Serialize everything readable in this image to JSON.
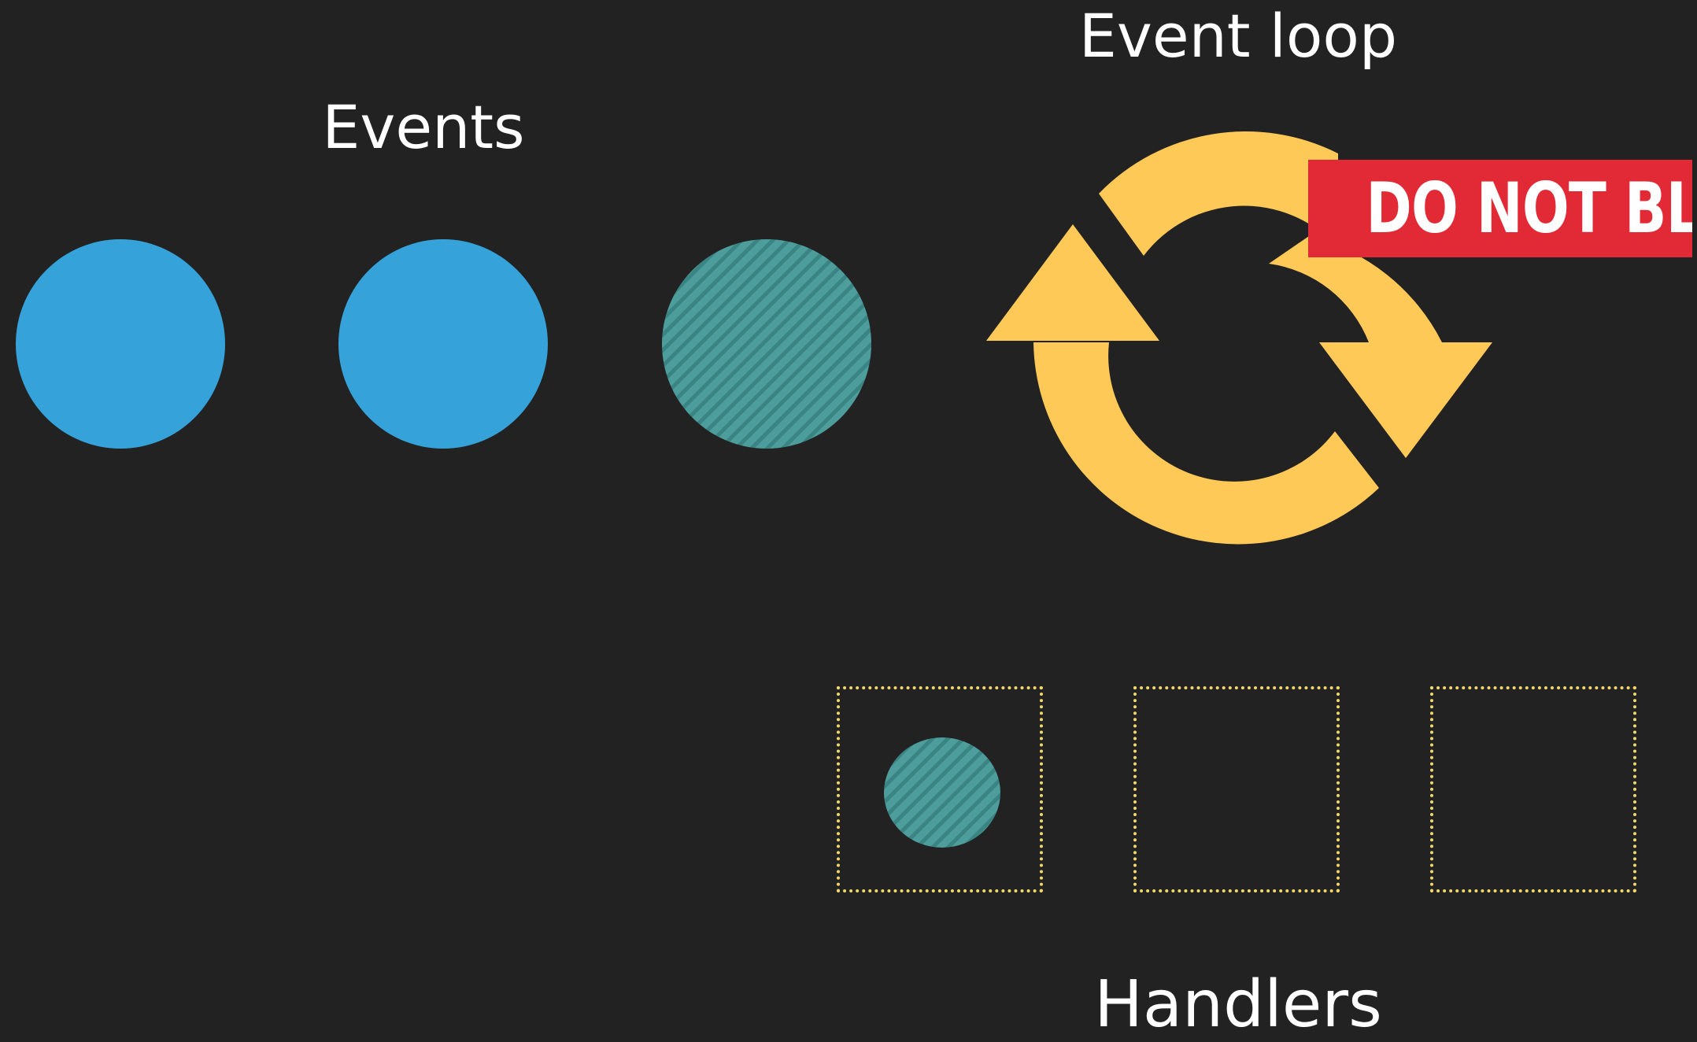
{
  "labels": {
    "event_loop": "Event loop",
    "events": "Events",
    "handlers": "Handlers",
    "warning": "DO NOT BLOCK"
  },
  "colors": {
    "background": "#222222",
    "event_blue": "#35a3da",
    "event_teal": "#4c9d9b",
    "event_teal_stripe": "#3a8583",
    "loop_arrows": "#fec957",
    "warning_bg": "#e12a35",
    "handler_border": "#f2d86a",
    "text": "#ffffff"
  },
  "icons": {
    "loop": "cycle-arrows-icon"
  },
  "events": [
    {
      "state": "queued"
    },
    {
      "state": "queued"
    },
    {
      "state": "processing"
    }
  ],
  "handlers": [
    {
      "state": "busy"
    },
    {
      "state": "idle"
    },
    {
      "state": "idle"
    }
  ]
}
